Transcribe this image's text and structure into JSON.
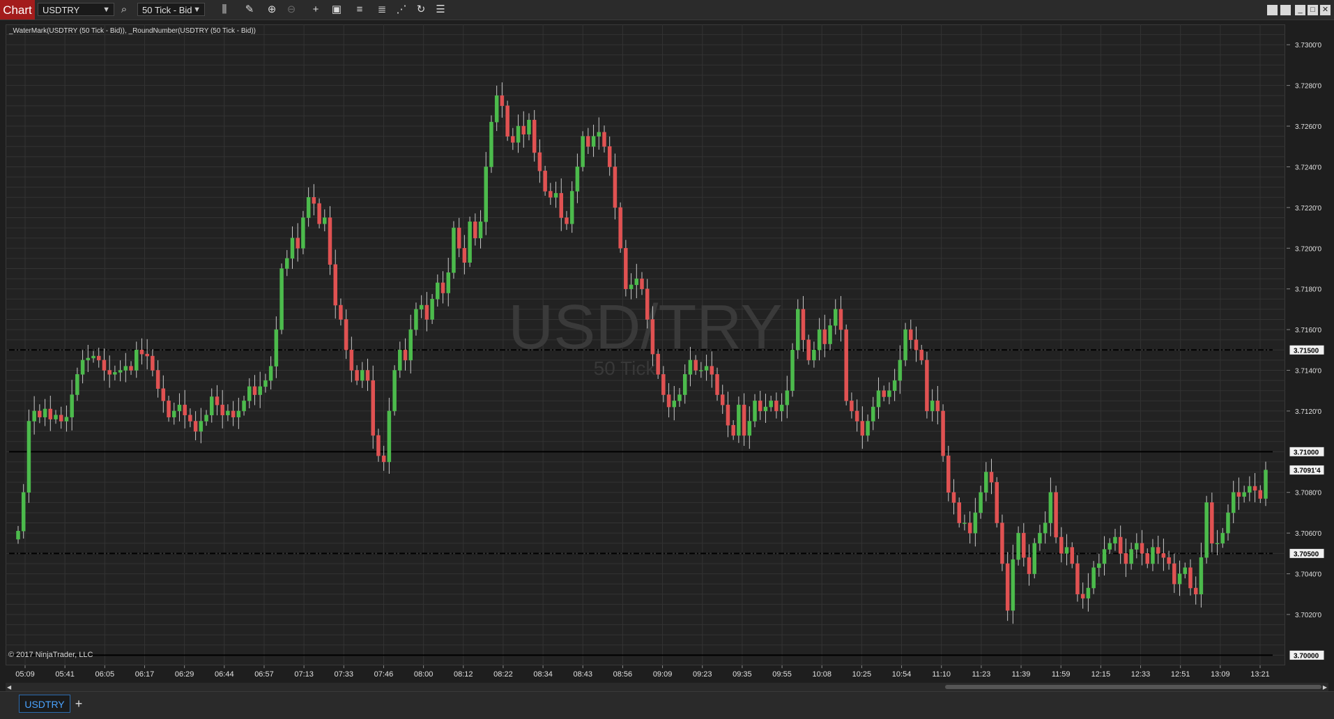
{
  "toolbar": {
    "chart_tab_label": "Chart",
    "instrument": "USDTRY",
    "bar_type": "50 Tick - Bid"
  },
  "indicators_label": "_WaterMark(USDTRY (50 Tick - Bid)), _RoundNumber(USDTRY (50 Tick - Bid))",
  "watermark": {
    "symbol": "USD/TRY",
    "period": "50 Tick"
  },
  "copyright": "© 2017 NinjaTrader, LLC",
  "instrument_tab": "USDTRY",
  "colors": {
    "up": "#4cbb4c",
    "down": "#e05252",
    "background": "#222222",
    "grid": "#333333",
    "label_bg": "#f0f0f0"
  },
  "chart_data": {
    "type": "candlestick",
    "y_range": [
      3.6995,
      3.731
    ],
    "y_ticks": [
      {
        "v": 3.73,
        "t": "3.7300'0"
      },
      {
        "v": 3.728,
        "t": "3.7280'0"
      },
      {
        "v": 3.726,
        "t": "3.7260'0"
      },
      {
        "v": 3.724,
        "t": "3.7240'0"
      },
      {
        "v": 3.722,
        "t": "3.7220'0"
      },
      {
        "v": 3.72,
        "t": "3.7200'0"
      },
      {
        "v": 3.718,
        "t": "3.7180'0"
      },
      {
        "v": 3.716,
        "t": "3.7160'0"
      },
      {
        "v": 3.714,
        "t": "3.7140'0"
      },
      {
        "v": 3.712,
        "t": "3.7120'0"
      },
      {
        "v": 3.708,
        "t": "3.7080'0"
      },
      {
        "v": 3.706,
        "t": "3.7060'0"
      },
      {
        "v": 3.704,
        "t": "3.7040'0"
      },
      {
        "v": 3.702,
        "t": "3.7020'0"
      }
    ],
    "round_number_lines": [
      {
        "price": 3.715,
        "label": "3.71500",
        "style": "dash-dot"
      },
      {
        "price": 3.71,
        "label": "3.71000",
        "style": "solid"
      },
      {
        "price": 3.705,
        "label": "3.70500",
        "style": "dash-dot"
      },
      {
        "price": 3.7,
        "label": "3.70000",
        "style": "solid"
      }
    ],
    "last_price": {
      "price": 3.7091,
      "label": "3.7091'4"
    },
    "x_ticks": [
      "05:09",
      "05:41",
      "06:05",
      "06:17",
      "06:29",
      "06:44",
      "06:57",
      "07:13",
      "07:33",
      "07:46",
      "08:00",
      "08:12",
      "08:22",
      "08:34",
      "08:43",
      "08:56",
      "09:09",
      "09:23",
      "09:35",
      "09:55",
      "10:08",
      "10:25",
      "10:54",
      "11:10",
      "11:23",
      "11:39",
      "11:59",
      "12:15",
      "12:33",
      "12:51",
      "13:09",
      "13:21"
    ],
    "closes": [
      3.7061,
      3.708,
      3.7115,
      3.712,
      3.7117,
      3.7121,
      3.7116,
      3.7118,
      3.7115,
      3.7117,
      3.7128,
      3.7138,
      3.7145,
      3.7146,
      3.7147,
      3.7145,
      3.714,
      3.7138,
      3.7139,
      3.714,
      3.7142,
      3.714,
      3.715,
      3.7148,
      3.7147,
      3.714,
      3.7131,
      3.7125,
      3.7117,
      3.712,
      3.7123,
      3.7118,
      3.7115,
      3.711,
      3.7115,
      3.7118,
      3.7127,
      3.7123,
      3.7118,
      3.712,
      3.7117,
      3.712,
      3.7125,
      3.7132,
      3.7128,
      3.7132,
      3.7135,
      3.7142,
      3.716,
      3.719,
      3.7195,
      3.7205,
      3.72,
      3.7215,
      3.7225,
      3.7222,
      3.7212,
      3.7215,
      3.7192,
      3.7172,
      3.7165,
      3.715,
      3.714,
      3.7135,
      3.714,
      3.7135,
      3.7108,
      3.7098,
      3.7095,
      3.712,
      3.714,
      3.715,
      3.7145,
      3.716,
      3.717,
      3.7172,
      3.7165,
      3.7175,
      3.7183,
      3.7178,
      3.7188,
      3.721,
      3.72,
      3.7193,
      3.7213,
      3.7205,
      3.7213,
      3.724,
      3.7262,
      3.7275,
      3.727,
      3.7255,
      3.7252,
      3.726,
      3.7256,
      3.7263,
      3.7247,
      3.7238,
      3.7228,
      3.7225,
      3.7227,
      3.7215,
      3.7212,
      3.7228,
      3.724,
      3.7255,
      3.725,
      3.7255,
      3.7257,
      3.725,
      3.724,
      3.722,
      3.72,
      3.718,
      3.7182,
      3.7185,
      3.718,
      3.7165,
      3.7148,
      3.7138,
      3.7128,
      3.7122,
      3.7125,
      3.7128,
      3.7138,
      3.7145,
      3.714,
      3.714,
      3.7142,
      3.7138,
      3.7128,
      3.7123,
      3.7113,
      3.7108,
      3.7123,
      3.7108,
      3.7115,
      3.7125,
      3.712,
      3.7122,
      3.7125,
      3.712,
      3.7123,
      3.713,
      3.715,
      3.717,
      3.7155,
      3.7145,
      3.715,
      3.716,
      3.7153,
      3.7162,
      3.717,
      3.716,
      3.7125,
      3.712,
      3.7115,
      3.7108,
      3.7115,
      3.7122,
      3.713,
      3.7127,
      3.713,
      3.7135,
      3.7145,
      3.716,
      3.7155,
      3.715,
      3.7145,
      3.712,
      3.7125,
      3.712,
      3.7098,
      3.708,
      3.7075,
      3.7065,
      3.7065,
      3.706,
      3.707,
      3.708,
      3.709,
      3.7085,
      3.7065,
      3.7045,
      3.7022,
      3.7047,
      3.706,
      3.7048,
      3.704,
      3.7055,
      3.706,
      3.7065,
      3.708,
      3.7058,
      3.705,
      3.7053,
      3.7045,
      3.703,
      3.7028,
      3.7033,
      3.7043,
      3.7045,
      3.7052,
      3.7055,
      3.7058,
      3.705,
      3.7045,
      3.7052,
      3.7055,
      3.705,
      3.7045,
      3.7053,
      3.705,
      3.7048,
      3.7045,
      3.7035,
      3.704,
      3.7043,
      3.7033,
      3.703,
      3.7048,
      3.7075,
      3.7055,
      3.7055,
      3.706,
      3.707,
      3.708,
      3.7078,
      3.708,
      3.7083,
      3.7081,
      3.7077,
      3.7091
    ]
  }
}
